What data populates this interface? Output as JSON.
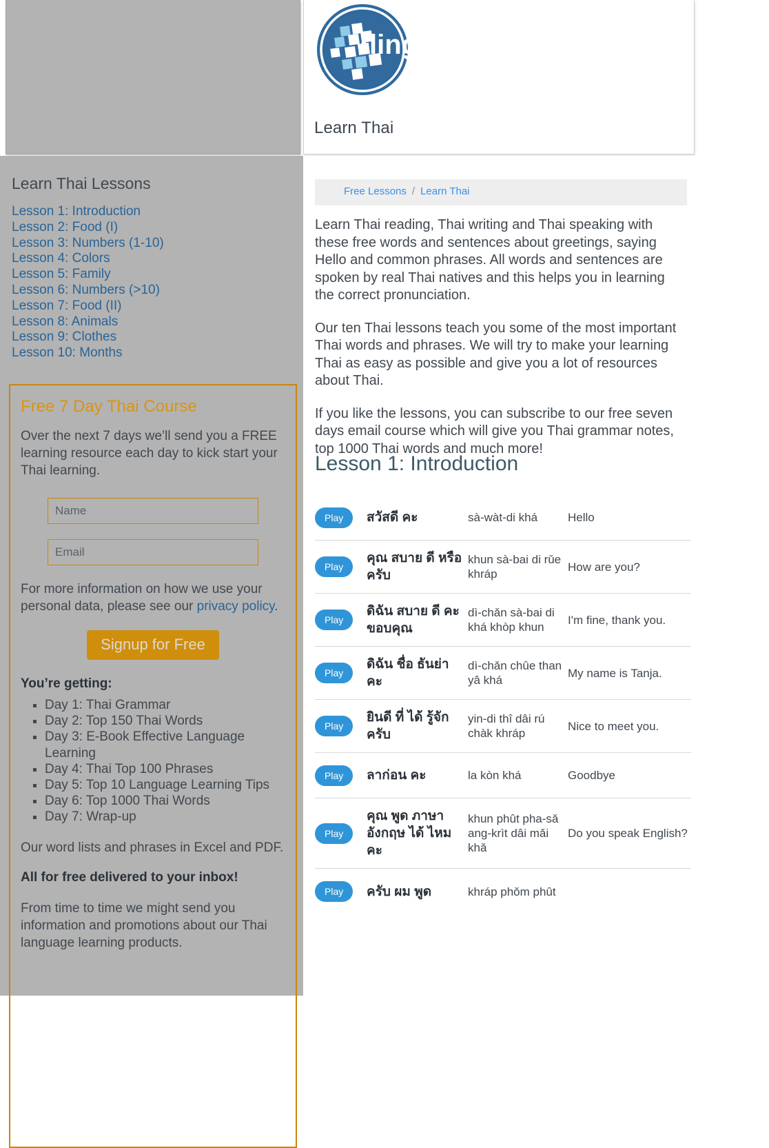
{
  "header": {
    "logo_alt": "lingo logo",
    "logo_wordmark": "lingo",
    "site_title": "Learn Thai"
  },
  "sidebar": {
    "heading": "Learn Thai Lessons",
    "lessons": [
      {
        "label": "Lesson 1: Introduction"
      },
      {
        "label": "Lesson 2: Food (I)"
      },
      {
        "label": "Lesson 3: Numbers (1-10)"
      },
      {
        "label": "Lesson 4: Colors"
      },
      {
        "label": "Lesson 5: Family"
      },
      {
        "label": "Lesson 6: Numbers (>10)"
      },
      {
        "label": "Lesson 7: Food (II)"
      },
      {
        "label": "Lesson 8: Animals"
      },
      {
        "label": "Lesson 9: Clothes"
      },
      {
        "label": "Lesson 10: Months"
      }
    ],
    "signup": {
      "title": "Free 7 Day Thai Course",
      "intro": "Over the next 7 days we’ll send you a FREE learning resource each day to kick start your Thai learning.",
      "name_placeholder": "Name",
      "name_value": "",
      "email_placeholder": "Email",
      "email_value": "",
      "privacy_prefix": "For more information on how we use your personal data, please see our ",
      "privacy_link": "privacy policy",
      "privacy_suffix": ".",
      "button_label": "Signup for Free",
      "getting_title": "You’re getting:",
      "days": [
        "Day 1: Thai Grammar",
        "Day 2: Top 150 Thai Words",
        "Day 3: E-Book Effective Language Learning",
        "Day 4: Thai Top 100 Phrases",
        "Day 5: Top 10 Language Learning Tips",
        "Day 6: Top 1000 Thai Words",
        "Day 7: Wrap-up"
      ],
      "formats_note": "Our word lists and phrases in Excel and PDF.",
      "free_note": "All for free delivered to your inbox!",
      "promo_note": "From time to time we might send you information and promotions about our Thai language learning products."
    }
  },
  "content": {
    "breadcrumb": {
      "items": [
        "Free Lessons",
        "Learn Thai"
      ],
      "separator": "/"
    },
    "paragraphs": [
      "Learn Thai reading, Thai writing and Thai speaking with these free words and sentences about greetings, saying Hello and common phrases. All words and sentences are spoken by real Thai natives and this helps you in learning the correct pronunciation.",
      "Our ten Thai lessons teach you some of the most important Thai words and phrases. We will try to make your learning Thai as easy as possible and give you a lot of resources about Thai.",
      "If you like the lessons, you can subscribe to our free seven days email course which will give you Thai grammar notes, top 1000 Thai words and much more!"
    ],
    "lesson_heading": "Lesson 1: Introduction",
    "play_label": "Play",
    "phrases": [
      {
        "thai": "สวัสดี คะ",
        "translit": "sà-wàt-di khá",
        "english": "Hello"
      },
      {
        "thai": "คุณ สบาย ดี หรือ ครับ",
        "translit": "khun sà-bai di rǔe khráp",
        "english": "How are you?"
      },
      {
        "thai": "ดิฉัน สบาย ดี คะ ขอบคุณ",
        "translit": "dì-chǎn sà-bai di khá khòp khun",
        "english": "I'm fine, thank you."
      },
      {
        "thai": "ดิฉัน ชื่อ ธันย่า คะ",
        "translit": "dì-chǎn chûe than yâ khá",
        "english": "My name is Tanja."
      },
      {
        "thai": "ยินดี ที่ ได้ รู้จัก ครับ",
        "translit": "yin-di thî dâi rú chàk khráp",
        "english": "Nice to meet you."
      },
      {
        "thai": "ลาก่อน คะ",
        "translit": "la kòn khá",
        "english": "Goodbye"
      },
      {
        "thai": "คุณ พูด ภาษา อังกฤษ ได้ ไหม คะ",
        "translit": "khun phût pha-sǎ ang-krìt dâi mǎi khǎ",
        "english": "Do you speak English?"
      },
      {
        "thai": "ครับ ผม พูด",
        "translit": "khráp phǒm phût",
        "english": ""
      }
    ]
  }
}
